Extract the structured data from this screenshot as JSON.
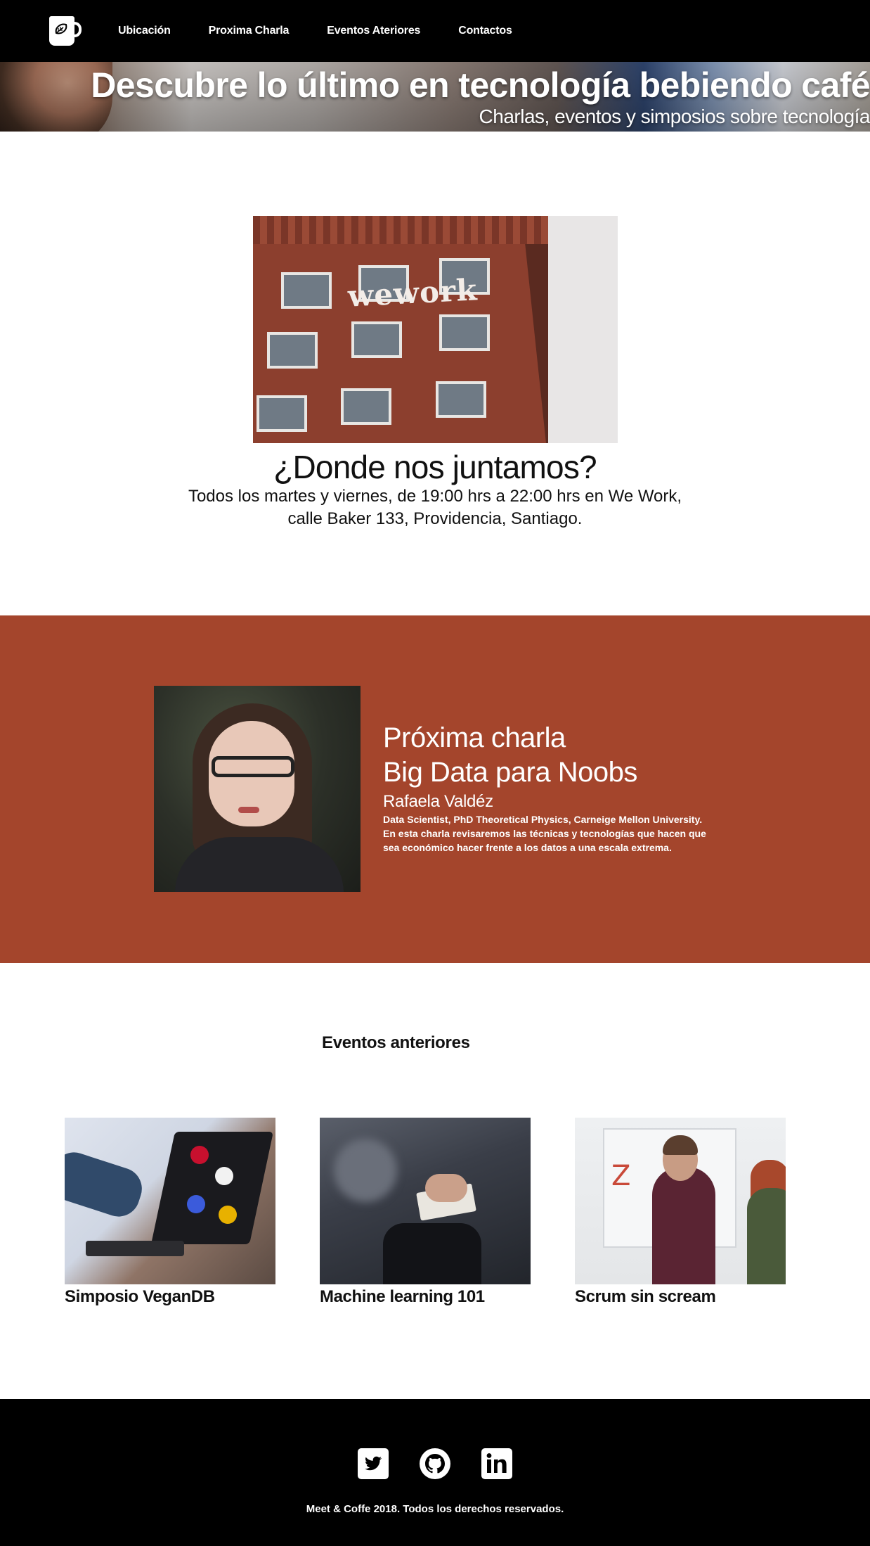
{
  "nav": {
    "items": [
      {
        "label": "Ubicación"
      },
      {
        "label": "Proxima Charla"
      },
      {
        "label": "Eventos Ateriores"
      },
      {
        "label": "Contactos"
      }
    ]
  },
  "hero": {
    "title": "Descubre lo último en tecnología bebiendo café",
    "subtitle": "Charlas, eventos y simposios sobre tecnología"
  },
  "location": {
    "building_sign": "wework",
    "title": "¿Donde nos juntamos?",
    "text": "Todos los martes y viernes, de 19:00 hrs a 22:00 hrs en We Work, calle Baker 133, Providencia, Santiago."
  },
  "next_talk": {
    "kicker": "Próxima charla",
    "title": "Big Data para Noobs",
    "speaker": "Rafaela Valdéz",
    "bio": "Data Scientist, PhD Theoretical Physics, Carneige Mellon University.",
    "description": "En esta charla revisaremos las técnicas y tecnologías que hacen que sea económico hacer frente a los datos a una escala extrema."
  },
  "past_events": {
    "title": "Eventos anteriores",
    "items": [
      {
        "label": "Simposio VeganDB"
      },
      {
        "label": "Machine learning 101"
      },
      {
        "label": "Scrum sin scream"
      }
    ]
  },
  "footer": {
    "icons": [
      "twitter-icon",
      "github-icon",
      "linkedin-icon"
    ],
    "copyright": "Meet & Coffe 2018. Todos los derechos reservados."
  },
  "colors": {
    "nav_bg": "#000000",
    "talk_bg": "#a4452c",
    "footer_bg": "#000000"
  }
}
